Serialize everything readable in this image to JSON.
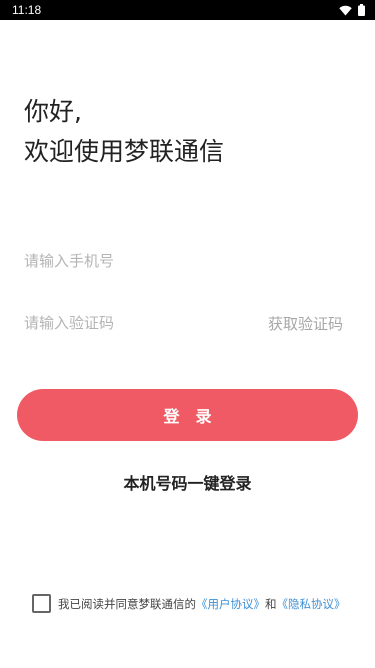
{
  "status_bar": {
    "time": "11:18",
    "icons": [
      "wifi-icon",
      "battery-icon"
    ]
  },
  "greeting": {
    "line1": "你好,",
    "line2": "欢迎使用梦联通信"
  },
  "phone_field": {
    "placeholder": "请输入手机号",
    "value": ""
  },
  "code_field": {
    "placeholder": "请输入验证码",
    "value": "",
    "get_code_label": "获取验证码"
  },
  "login_button": {
    "label": "登录",
    "color": "#f05a64"
  },
  "one_key_login": {
    "label": "本机号码一键登录"
  },
  "agreement": {
    "checked": false,
    "prefix": "我已阅读并同意梦联通信的",
    "user_agreement": "《用户协议》",
    "conjunction": "和",
    "privacy_policy": "《隐私协议》",
    "link_color": "#3d8fd6"
  }
}
